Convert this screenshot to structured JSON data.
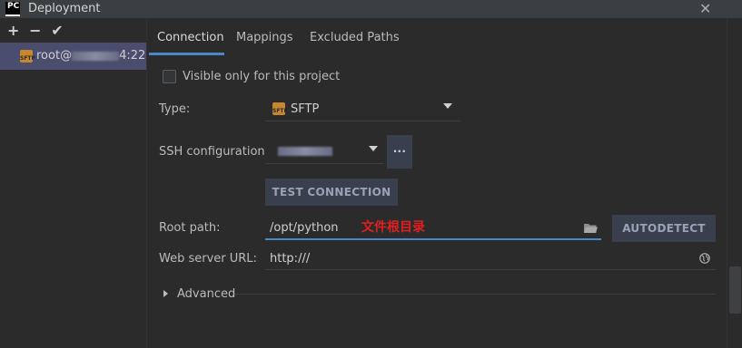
{
  "window": {
    "title": "Deployment",
    "app_badge": "PC"
  },
  "toolbar": {
    "add": "+",
    "remove": "−",
    "apply": "✔"
  },
  "servers": [
    {
      "name_prefix": "root@",
      "name_suffix": "4:22",
      "type_badge": "SFTP"
    }
  ],
  "tabs": [
    {
      "label": "Connection",
      "active": true
    },
    {
      "label": "Mappings",
      "active": false
    },
    {
      "label": "Excluded Paths",
      "active": false
    }
  ],
  "form": {
    "visible_only_label": "Visible only for this project",
    "type_label": "Type:",
    "type_value": "SFTP",
    "type_badge": "SFTP",
    "ssh_label": "SSH configuration:",
    "ssh_more": "...",
    "test_connection": "TEST CONNECTION",
    "root_path_label": "Root path:",
    "root_path_value": "/opt/python",
    "root_path_note": "文件根目录",
    "autodetect": "AUTODETECT",
    "web_url_label": "Web server URL:",
    "web_url_value": "http:///",
    "advanced_label": "Advanced"
  },
  "colors": {
    "accent": "#4a88c7",
    "selection": "#4b4d6f",
    "annotation": "#e02020"
  }
}
